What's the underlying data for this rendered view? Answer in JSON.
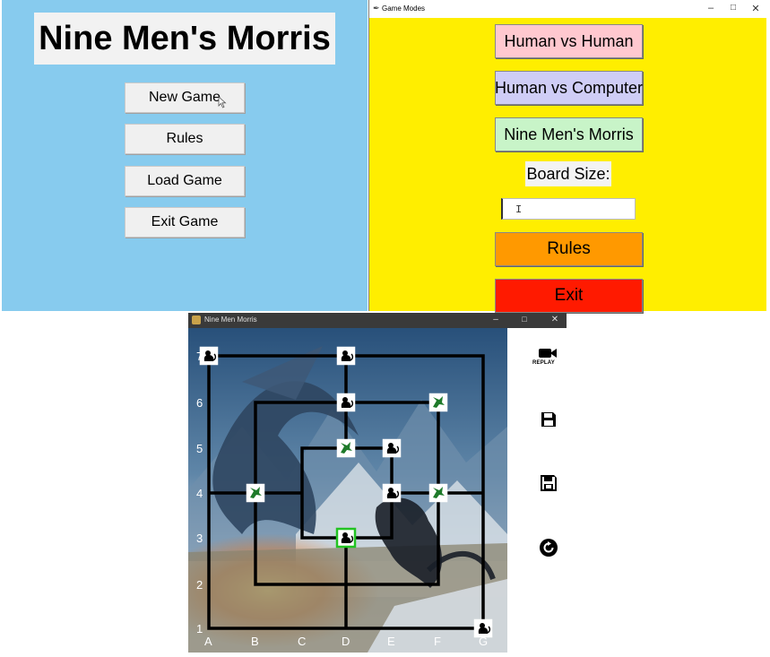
{
  "main_menu": {
    "title": "Nine Men's Morris",
    "buttons": [
      "New Game",
      "Rules",
      "Load Game",
      "Exit Game"
    ]
  },
  "modes_window": {
    "title": "Game Modes",
    "controls": [
      "–",
      "□",
      "✕"
    ],
    "buttons": [
      {
        "label": "Human vs Human",
        "color": "#ffc8cf"
      },
      {
        "label": "Human vs Computer",
        "color": "#cfcdf6"
      },
      {
        "label": "Nine Men's Morris",
        "color": "#c8f4c8"
      }
    ],
    "board_size_label": "Board Size:",
    "board_size_value": "",
    "rules_button": {
      "label": "Rules",
      "color": "#ff9900"
    },
    "exit_button": {
      "label": "Exit",
      "color": "#ff1a00"
    }
  },
  "game_window": {
    "title": "Nine Men Morris",
    "controls": [
      "–",
      "□",
      "✕"
    ],
    "replay_label": "REPLAY",
    "row_labels": [
      "1",
      "2",
      "3",
      "4",
      "5",
      "6",
      "7"
    ],
    "col_labels": [
      "A",
      "B",
      "C",
      "D",
      "E",
      "F",
      "G"
    ],
    "pieces": [
      {
        "pos": "A7",
        "player": "black"
      },
      {
        "pos": "D7",
        "player": "black"
      },
      {
        "pos": "D6",
        "player": "black"
      },
      {
        "pos": "F6",
        "player": "green"
      },
      {
        "pos": "D5",
        "player": "green"
      },
      {
        "pos": "E5",
        "player": "black"
      },
      {
        "pos": "B4",
        "player": "green"
      },
      {
        "pos": "E4",
        "player": "black"
      },
      {
        "pos": "F4",
        "player": "green"
      },
      {
        "pos": "D3",
        "player": "black",
        "selected": true
      },
      {
        "pos": "G1",
        "player": "black"
      }
    ],
    "colors": {
      "black_piece": "#000000",
      "green_piece": "#1e7a2a",
      "selected": "#22c322"
    }
  }
}
